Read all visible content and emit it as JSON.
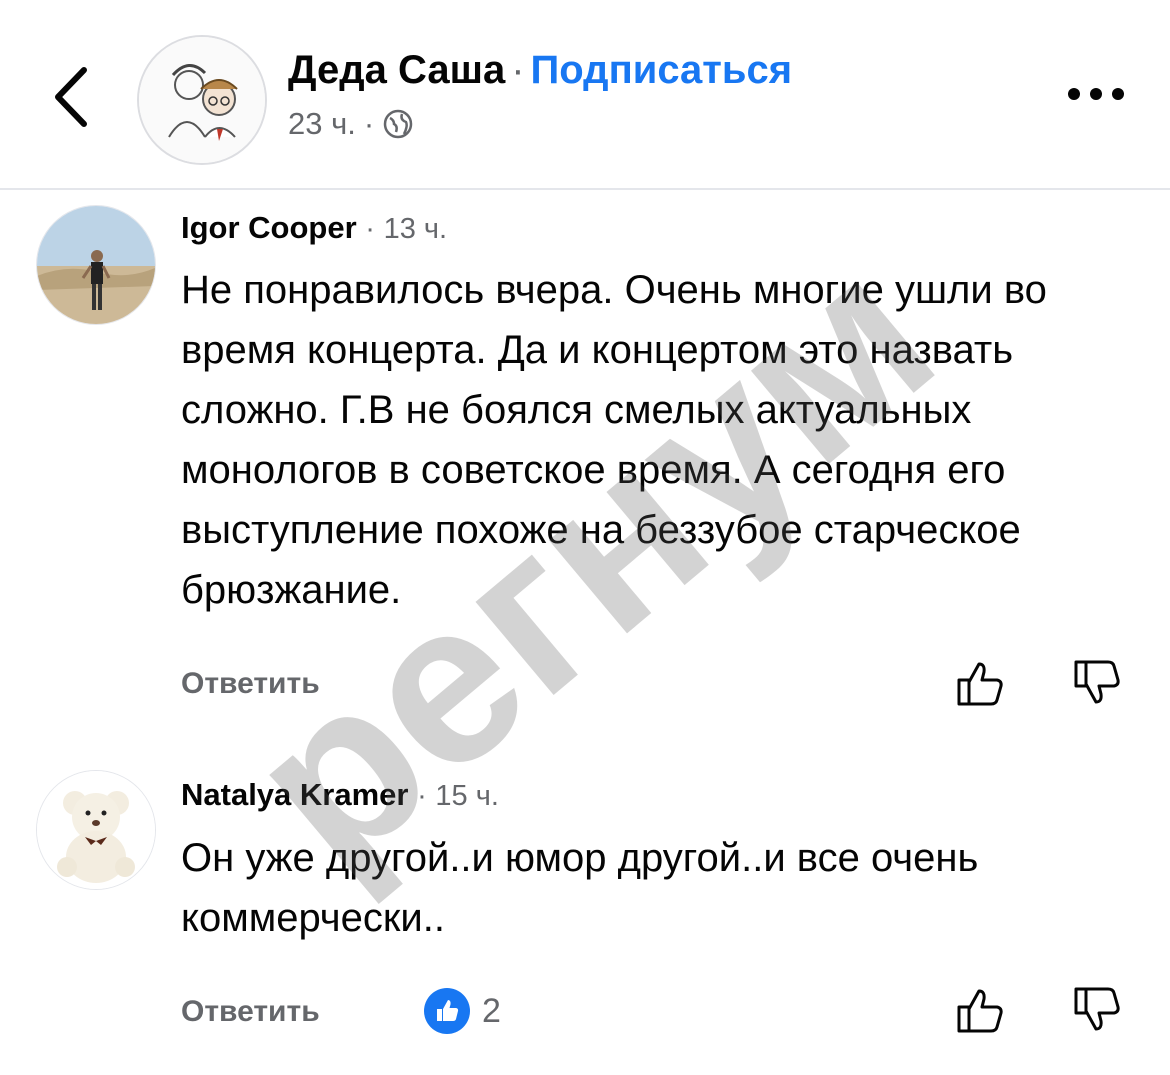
{
  "header": {
    "page_name": "Деда Саша",
    "separator": "·",
    "follow_label": "Подписаться",
    "time": "23 ч.",
    "time_separator": "·",
    "globe_icon": "globe-icon",
    "more_icon": "more-icon"
  },
  "comments": [
    {
      "author": "Igor Cooper",
      "separator": "·",
      "time": "13 ч.",
      "text": "Не понравилось вчера. Очень многие ушли во время концерта. Да и концертом это назвать сложно. Г.В не боялся смелых актуальных монологов в советское время. А сегодня его выступление похоже на беззубое старческое брюзжание.",
      "reply_label": "Ответить"
    },
    {
      "author": "Natalya Kramer",
      "separator": "·",
      "time": "15 ч.",
      "text": "Он уже другой..и юмор другой..и все очень коммерчески..",
      "reply_label": "Ответить",
      "reaction_count": "2"
    }
  ],
  "watermark": "регнум",
  "colors": {
    "accent": "#1877f2",
    "muted": "#65676b",
    "text": "#050505"
  }
}
